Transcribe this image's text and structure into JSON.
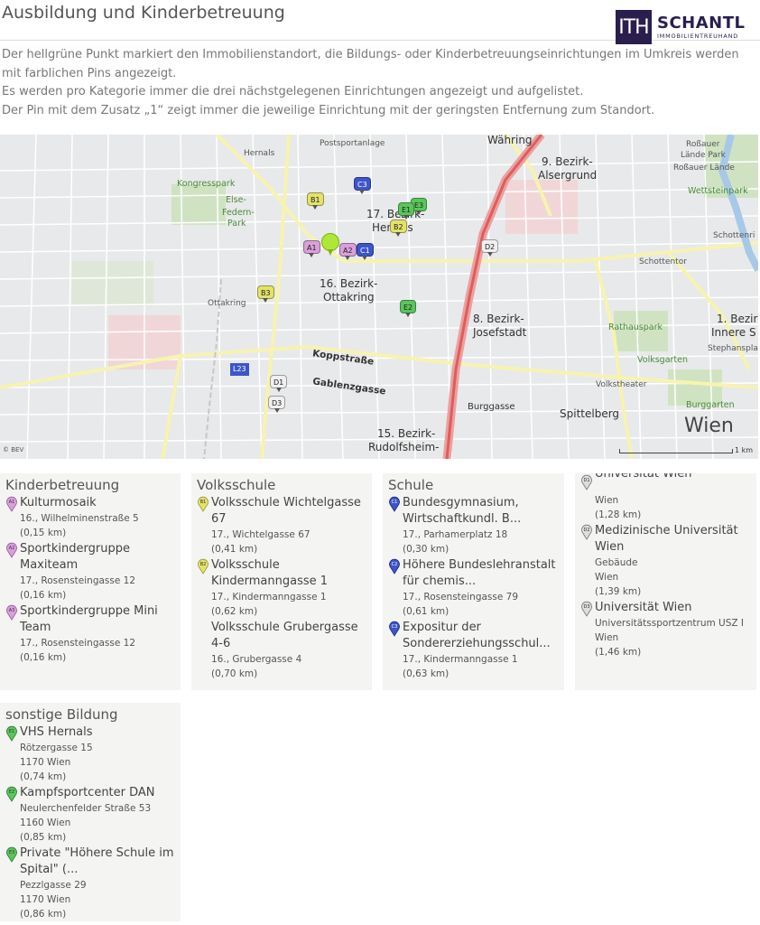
{
  "header": {
    "title": "Ausbildung und Kinderbetreuung",
    "logo_name": "SCHANTL",
    "logo_sub": "IMMOBILIENTREUHAND",
    "logo_mark": "ITH"
  },
  "intro": [
    "Der hellgrüne Punkt markiert den Immobilienstandort, die Bildungs- oder Kinderbetreuungseinrichtungen im Umkreis werden mit farblichen Pins angezeigt.",
    "Es werden pro Kategorie immer die drei nächstgelegenen Einrichtungen angezeigt und aufgelistet.",
    "Der Pin mit dem Zusatz „1“ zeigt immer die jeweilige Einrichtung mit der geringsten Entfernung zum Standort."
  ],
  "map": {
    "labels": {
      "waehring": "Währing",
      "postsportanlage": "Postsportanlage",
      "hernals": "Hernals",
      "kongresspark": "Kongresspark",
      "else": "Else-",
      "federn": "Federn-",
      "park": "Park",
      "bezirk9a": "9. Bezirk-",
      "bezirk9b": "Alsergrund",
      "bezirk17a": "17. Bezirk-",
      "bezirk17b": "Hernals",
      "bezirk16a": "16. Bezirk-",
      "bezirk16b": "Ottakring",
      "bezirk8a": "8. Bezirk-",
      "bezirk8b": "Josefstadt",
      "bezirk1a": "1. Bezir",
      "bezirk1b": "Innere S",
      "bezirk15a": "15. Bezirk-",
      "bezirk15b": "Rudolfsheim-",
      "ottakring": "Ottakring",
      "koppstrasse": "Koppstraße",
      "gablenzgasse": "Gablenzgasse",
      "burggasse": "Burggasse",
      "spittelberg": "Spittelberg",
      "wien": "Wien",
      "rossauer1": "Roßauer",
      "rossauer2": "Lände Park",
      "rossauer3": "Roßauer Lände",
      "wettsteinpark": "Wettsteinpark",
      "schottenring": "Schottenri",
      "schottentor": "Schottentor",
      "rathauspark": "Rathauspark",
      "stephansplatz": "Stephanspla",
      "volksgarten": "Volksgarten",
      "volkstheater": "Volkstheater",
      "burggarten": "Burggarten",
      "road_l23": "L23",
      "copyright": "© BEV",
      "scale": "1 km"
    },
    "pins": [
      "A1",
      "A2",
      "B1",
      "B2",
      "B3",
      "C1",
      "C2",
      "D1",
      "D2",
      "D3",
      "E1",
      "E2",
      "E3"
    ]
  },
  "categories": {
    "kinderbetreuung": {
      "title": "Kinderbetreuung",
      "color": "#d9a0dc",
      "items": [
        {
          "pin": "A1",
          "name": "Kulturmosaik",
          "address": "16., Wilhelminenstraße 5",
          "distance": "(0,15 km)"
        },
        {
          "pin": "A2",
          "name": "Sportkindergruppe Maxiteam",
          "address": "17., Rosensteingasse 12",
          "distance": "(0,16 km)"
        },
        {
          "pin": "A3",
          "name": "Sportkindergruppe Mini Team",
          "address": "17., Rosensteingasse 12",
          "distance": "(0,16 km)"
        }
      ]
    },
    "volksschule": {
      "title": "Volksschule",
      "color": "#e3e26a",
      "items": [
        {
          "pin": "B1",
          "name": "Volksschule Wichtelgasse 67",
          "address": "17., Wichtelgasse 67",
          "distance": "(0,41 km)"
        },
        {
          "pin": "B2",
          "name": "Volksschule Kindermanngasse 1",
          "address": "17., Kindermanngasse 1",
          "distance": "(0,62 km)"
        },
        {
          "pin": "B3",
          "name": "Volksschule Grubergasse 4-6",
          "address": "16., Grubergasse 4",
          "distance": "(0,70 km)"
        }
      ]
    },
    "schule": {
      "title": "Schule",
      "color": "#3d55c9",
      "items": [
        {
          "pin": "C1",
          "name": "Bundesgymnasium, Wirtschaftkundl. B...",
          "address": "17., Parhamerplatz 18",
          "distance": "(0,30 km)"
        },
        {
          "pin": "C2",
          "name": "Höhere Bundeslehranstalt für chemis...",
          "address": "17., Rosensteingasse 79",
          "distance": "(0,61 km)"
        },
        {
          "pin": "C3",
          "name": "Expositur der Sondererziehungsschul...",
          "address": "17., Kindermanngasse 1",
          "distance": "(0,63 km)"
        }
      ]
    },
    "universitaet": {
      "color": "#bbbbbb",
      "items": [
        {
          "pin": "D1",
          "name": "Universität Wien",
          "address": "Wien",
          "distance": "(1,28 km)"
        },
        {
          "pin": "D2",
          "name": "Medizinische Universität Wien",
          "address": "Gebäude",
          "city": "Wien",
          "distance": "(1,39 km)"
        },
        {
          "pin": "D3",
          "name": "Universität Wien",
          "address": "Universitätssportzentrum USZ I",
          "city": "Wien",
          "distance": "(1,46 km)"
        }
      ]
    },
    "sonstige": {
      "title": "sonstige Bildung",
      "color": "#59c75a",
      "items": [
        {
          "pin": "E1",
          "name": "VHS Hernals",
          "address": "Rötzergasse 15",
          "city": "1170 Wien",
          "distance": "(0,74 km)"
        },
        {
          "pin": "E2",
          "name": "Kampfsportcenter DAN",
          "address": "Neulerchenfelder Straße 53",
          "city": "1160 Wien",
          "distance": "(0,85 km)"
        },
        {
          "pin": "E3",
          "name": "Private \"Höhere Schule im Spital\" (...",
          "address": "Pezzlgasse 29",
          "city": "1170 Wien",
          "distance": "(0,86 km)"
        }
      ]
    }
  }
}
